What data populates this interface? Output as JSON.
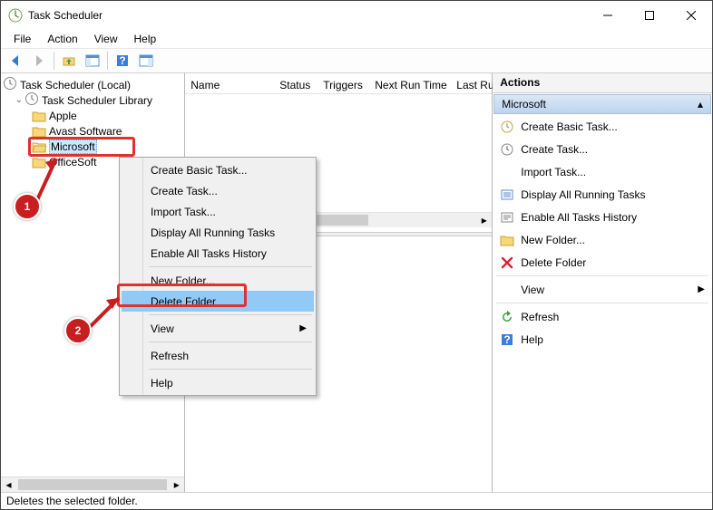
{
  "window": {
    "title": "Task Scheduler"
  },
  "menu": {
    "file": "File",
    "action": "Action",
    "view": "View",
    "help": "Help"
  },
  "tree": {
    "root": "Task Scheduler (Local)",
    "library": "Task Scheduler Library",
    "items": [
      "Apple",
      "Avast Software",
      "Microsoft",
      "OfficeSoft"
    ]
  },
  "columns": {
    "name": "Name",
    "status": "Status",
    "triggers": "Triggers",
    "next": "Next Run Time",
    "last": "Last Ru"
  },
  "context_menu": {
    "create_basic": "Create Basic Task...",
    "create": "Create Task...",
    "import": "Import Task...",
    "display_running": "Display All Running Tasks",
    "enable_history": "Enable All Tasks History",
    "new_folder": "New Folder...",
    "delete_folder": "Delete Folder",
    "view": "View",
    "refresh": "Refresh",
    "help": "Help"
  },
  "actions": {
    "header": "Actions",
    "group": "Microsoft",
    "create_basic": "Create Basic Task...",
    "create": "Create Task...",
    "import": "Import Task...",
    "display_running": "Display All Running Tasks",
    "enable_history": "Enable All Tasks History",
    "new_folder": "New Folder...",
    "delete_folder": "Delete Folder",
    "view": "View",
    "refresh": "Refresh",
    "help": "Help"
  },
  "status": "Deletes the selected folder.",
  "annotations": {
    "1": "1",
    "2": "2"
  }
}
